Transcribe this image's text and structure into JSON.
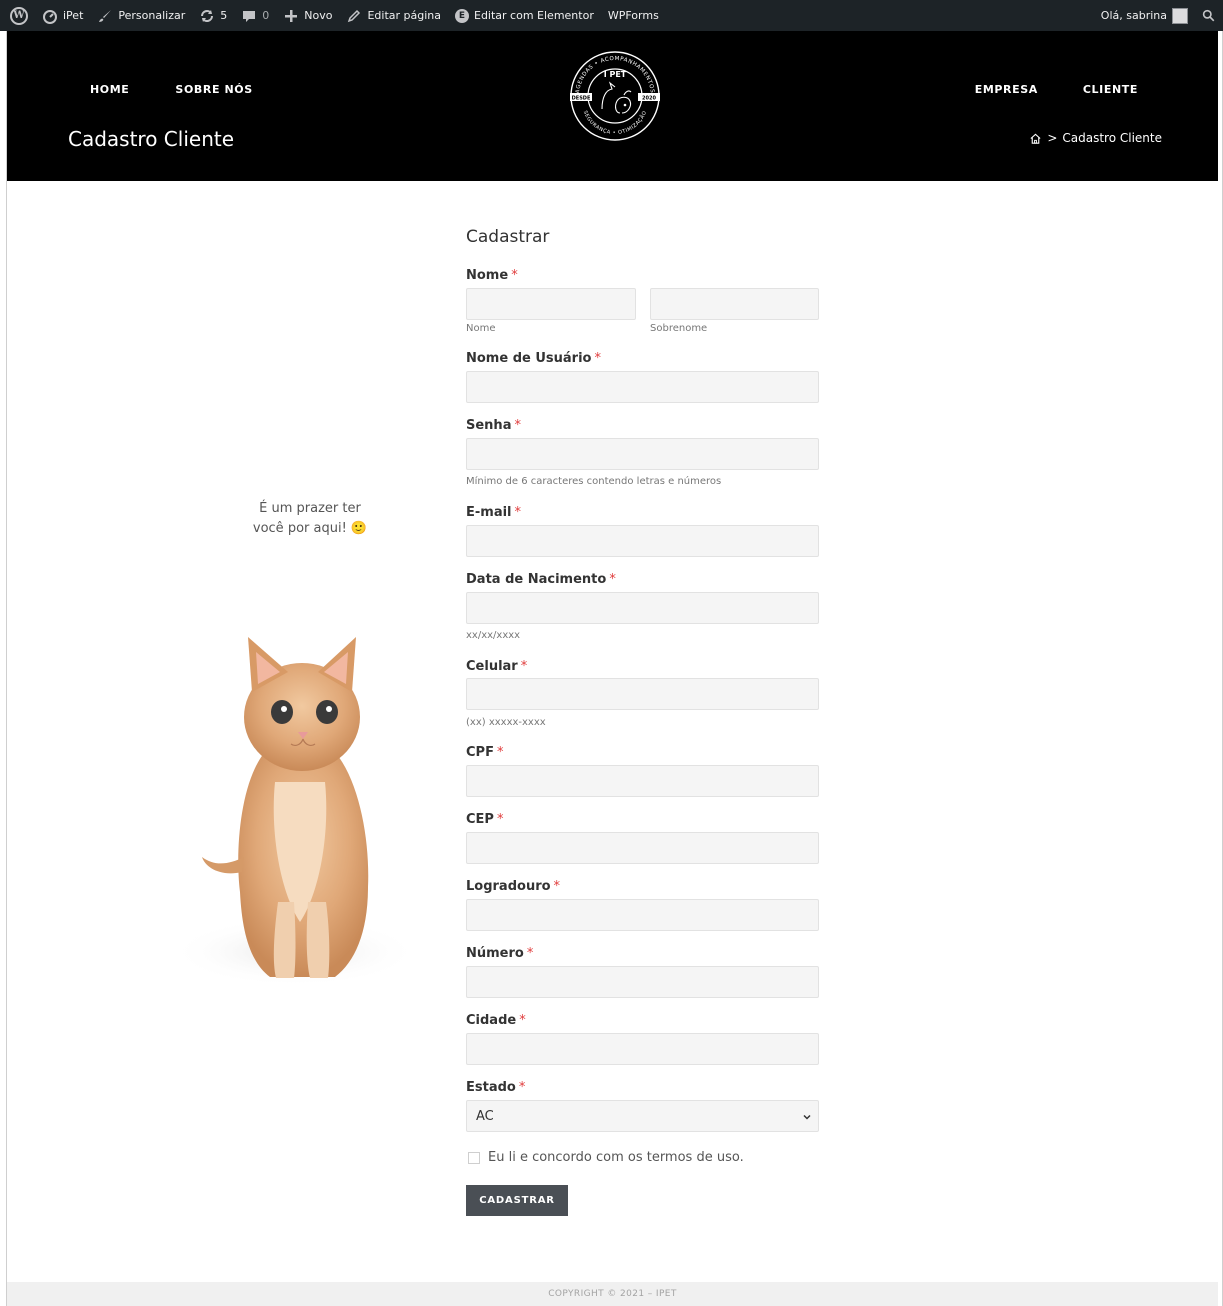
{
  "admin_bar": {
    "site_name": "iPet",
    "customize": "Personalizar",
    "updates_count": "5",
    "comments_count": "0",
    "new": "Novo",
    "edit_page": "Editar página",
    "edit_elementor": "Editar com Elementor",
    "wpforms": "WPForms",
    "greeting": "Olá, sabrina"
  },
  "header": {
    "nav_left": [
      "HOME",
      "SOBRE NÓS"
    ],
    "nav_right": [
      "EMPRESA",
      "CLIENTE"
    ],
    "page_title": "Cadastro Cliente",
    "breadcrumb_current": "Cadastro Cliente",
    "breadcrumb_separator": ">",
    "logo": {
      "name": "I PET",
      "top_arc": "AGENDAS • ACOMPANHAMENTOS",
      "bottom_arc": "SEGURANÇA • OTIMIZAÇÃO",
      "left_tag": "DESDE",
      "right_tag": "2020"
    }
  },
  "welcome": {
    "line1": "É um prazer ter",
    "line2": "você por aqui! 🙂"
  },
  "form": {
    "title": "Cadastrar",
    "required_mark": "*",
    "nome_label": "Nome",
    "first_sublabel": "Nome",
    "last_sublabel": "Sobrenome",
    "username_label": "Nome de Usuário",
    "senha_label": "Senha",
    "senha_hint": "Mínimo de 6 caracteres contendo letras e números",
    "email_label": "E-mail",
    "birth_label": "Data de Nacimento",
    "birth_hint": "xx/xx/xxxx",
    "cel_label": "Celular",
    "cel_hint": "(xx) xxxxx-xxxx",
    "cpf_label": "CPF",
    "cep_label": "CEP",
    "logradouro_label": "Logradouro",
    "numero_label": "Número",
    "cidade_label": "Cidade",
    "estado_label": "Estado",
    "estado_value": "AC",
    "terms_label": "Eu li e concordo com os termos de uso.",
    "submit_label": "CADASTRAR"
  },
  "footer": {
    "copyright": "COPYRIGHT © 2021 – IPET"
  },
  "colors": {
    "admin_bar": "#1d2327",
    "header_bg": "#000000",
    "required": "#e03b3b",
    "button": "#4a4f55",
    "input_bg": "#f5f5f5"
  },
  "icons": [
    "wordpress-icon",
    "dashboard-icon",
    "brush-icon",
    "updates-icon",
    "comment-icon",
    "plus-icon",
    "pencil-icon",
    "elementor-icon",
    "search-icon",
    "home-icon",
    "chevron-down-icon",
    "smile-icon"
  ]
}
